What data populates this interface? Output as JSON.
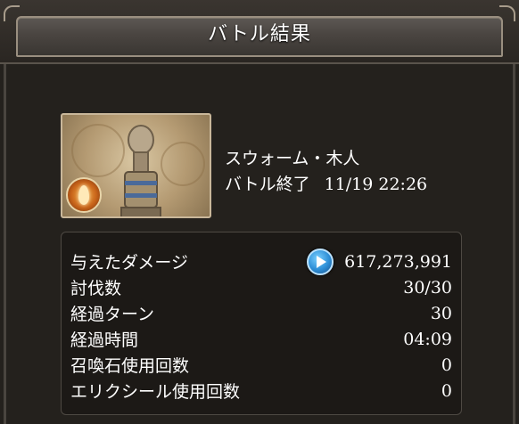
{
  "header": {
    "title": "バトル結果"
  },
  "boss": {
    "name": "スウォーム・木人",
    "end_label": "バトル終了",
    "end_time": "11/19 22:26"
  },
  "stats": [
    {
      "label": "与えたダメージ",
      "value": "617,273,991",
      "has_button": true
    },
    {
      "label": "討伐数",
      "value": "30/30"
    },
    {
      "label": "経過ターン",
      "value": "30"
    },
    {
      "label": "経過時間",
      "value": "04:09"
    },
    {
      "label": "召喚石使用回数",
      "value": "0"
    },
    {
      "label": "エリクシール使用回数",
      "value": "0"
    }
  ],
  "icons": {
    "damage_detail": "play-icon",
    "element": "fire-element-icon"
  },
  "colors": {
    "panel_bg": "#24211d",
    "header_bar": "#4a4541",
    "thumb_border": "#c9b79a",
    "play_button": "#2d8ed6"
  }
}
